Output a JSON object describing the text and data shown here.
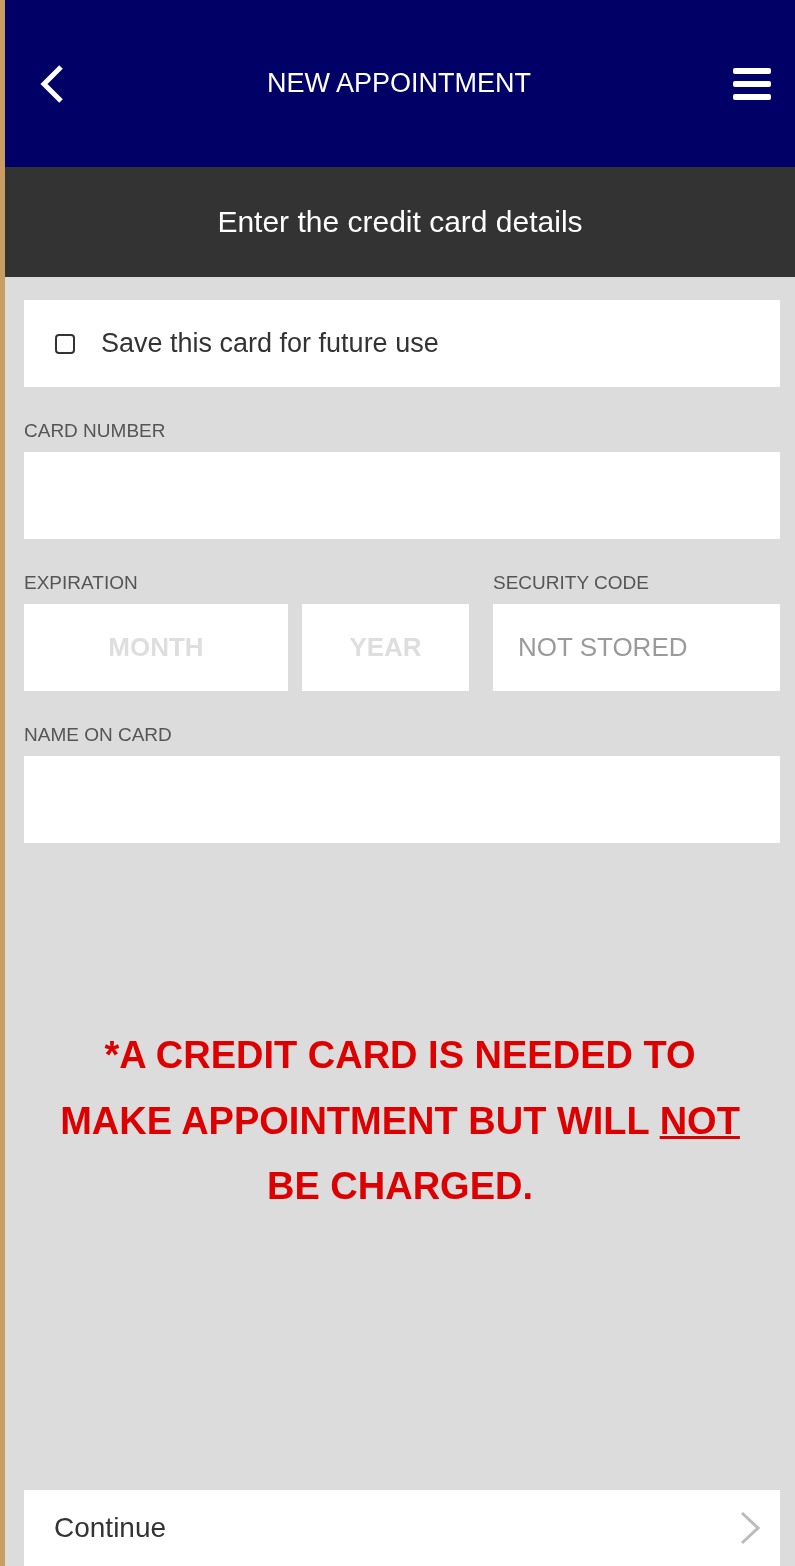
{
  "header": {
    "title": "NEW APPOINTMENT"
  },
  "subheader": {
    "title": "Enter the credit card details"
  },
  "save_card": {
    "label": "Save this card for future use",
    "checked": false
  },
  "card_number": {
    "label": "CARD NUMBER"
  },
  "expiration": {
    "label": "EXPIRATION",
    "month": {
      "placeholder": "MONTH"
    },
    "year": {
      "placeholder": "YEAR"
    }
  },
  "security_code": {
    "label": "SECURITY CODE",
    "placeholder": "NOT STORED"
  },
  "name_on_card": {
    "label": "NAME ON CARD"
  },
  "notice": {
    "before": "*A CREDIT CARD IS NEEDED TO MAKE APPOINTMENT BUT WILL ",
    "underlined": "NOT ",
    "after": "BE CHARGED."
  },
  "continue_button": {
    "label": "Continue"
  }
}
